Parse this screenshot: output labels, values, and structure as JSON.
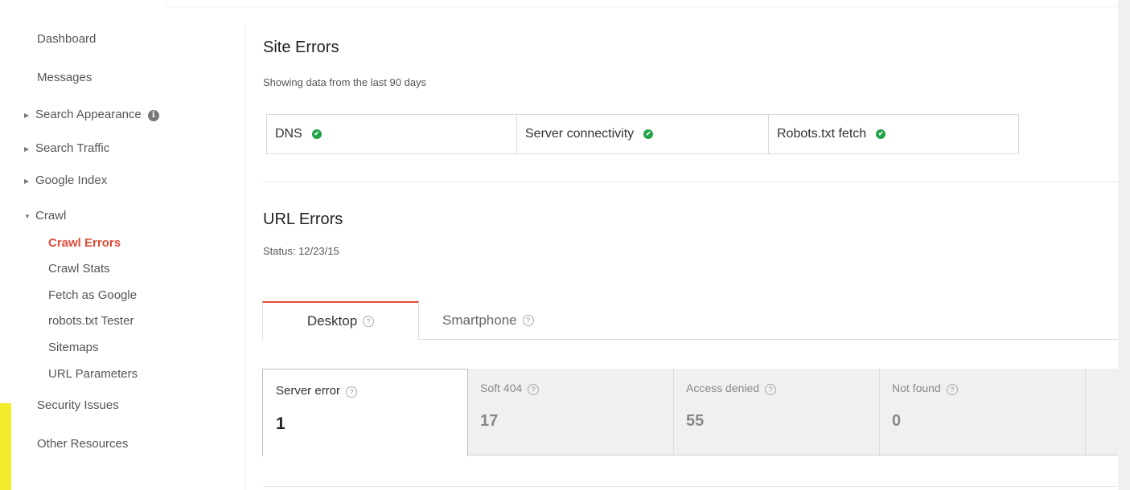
{
  "sidebar": {
    "dashboard": "Dashboard",
    "messages": "Messages",
    "search_appearance": "Search Appearance",
    "search_traffic": "Search Traffic",
    "google_index": "Google Index",
    "crawl": "Crawl",
    "crawl_items": [
      "Crawl Errors",
      "Crawl Stats",
      "Fetch as Google",
      "robots.txt Tester",
      "Sitemaps",
      "URL Parameters"
    ],
    "security_issues": "Security Issues",
    "other_resources": "Other Resources",
    "active_item": "Crawl Errors",
    "accent_color": "#dd4b39"
  },
  "site_errors": {
    "title": "Site Errors",
    "subtitle": "Showing data from the last 90 days",
    "checks": [
      {
        "label": "DNS",
        "status": "ok"
      },
      {
        "label": "Server connectivity",
        "status": "ok"
      },
      {
        "label": "Robots.txt fetch",
        "status": "ok"
      }
    ],
    "ok_color": "#21a348"
  },
  "url_errors": {
    "title": "URL Errors",
    "status": "Status: 12/23/15",
    "tabs": [
      "Desktop",
      "Smartphone"
    ],
    "active_tab": "Desktop",
    "metrics": [
      {
        "label": "Server error",
        "value": "1"
      },
      {
        "label": "Soft 404",
        "value": "17"
      },
      {
        "label": "Access denied",
        "value": "55"
      },
      {
        "label": "Not found",
        "value": "0"
      }
    ],
    "selected_metric": "Server error"
  },
  "icons": {
    "info": "i",
    "help": "?",
    "check": "✔",
    "collapsed": "▶",
    "expanded": "▼"
  }
}
